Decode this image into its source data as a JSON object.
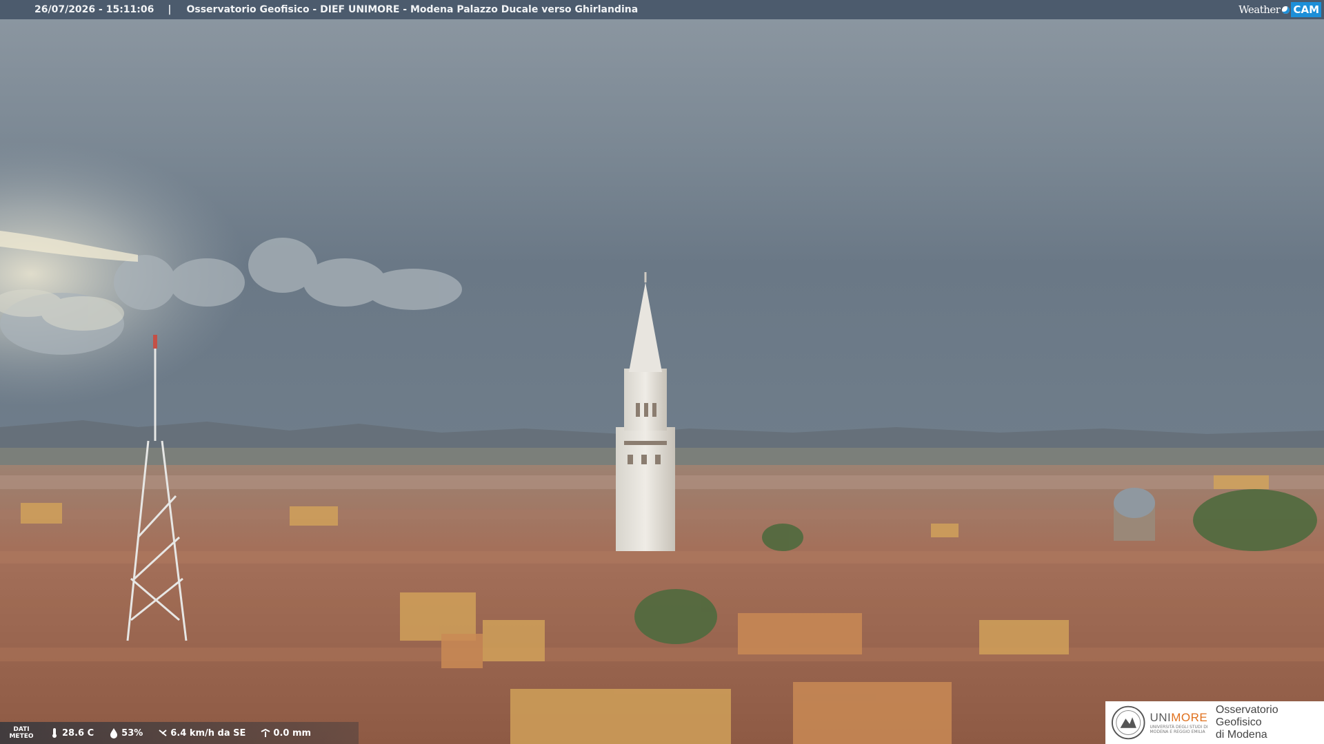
{
  "camera": {
    "timestamp": "26/07/2026 - 15:11:06",
    "separator": "|",
    "title": "Osservatorio Geofisico - DIEF UNIMORE - Modena Palazzo Ducale verso Ghirlandina"
  },
  "brand": {
    "weather": "Weather",
    "cam": "CAM"
  },
  "meteo": {
    "label_line1": "DATI",
    "label_line2": "METEO",
    "temperature": "28.6 C",
    "humidity": "53%",
    "wind": "6.4 km/h da SE",
    "rain": "0.0 mm"
  },
  "logo": {
    "unimore_uni": "UNI",
    "unimore_more": "MORE",
    "unimore_sub1": "UNIVERSITÀ DEGLI STUDI DI",
    "unimore_sub2": "MODENA E REGGIO EMILIA",
    "observatory_line1": "Osservatorio Geofisico",
    "observatory_line2": "di Modena"
  },
  "icons": {
    "thermometer": "thermometer-icon",
    "humidity": "droplet-icon",
    "wind": "wind-icon",
    "rain": "rain-icon"
  }
}
